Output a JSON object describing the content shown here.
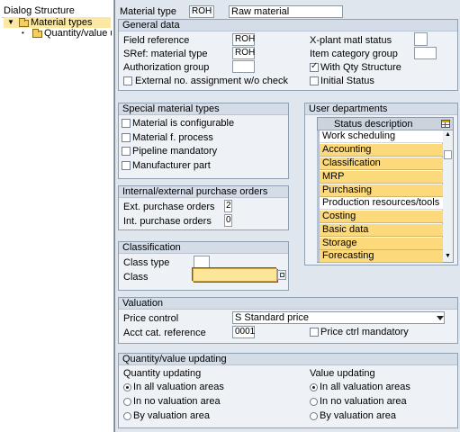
{
  "dialog_structure": {
    "title": "Dialog Structure",
    "items": [
      {
        "label": "Material types"
      },
      {
        "label": "Quantity/value upda"
      }
    ]
  },
  "header": {
    "material_type_label": "Material type",
    "material_type_code": "ROH",
    "material_type_desc": "Raw material"
  },
  "general_data": {
    "title": "General data",
    "field_reference_label": "Field reference",
    "field_reference_value": "ROH",
    "sref_label": "SRef: material type",
    "sref_value": "ROH",
    "auth_group_label": "Authorization group",
    "auth_group_value": "",
    "ext_no_label": "External no. assignment w/o check",
    "ext_no_checked": false,
    "xplant_label": "X-plant matl status",
    "xplant_value": "",
    "item_cat_label": "Item category group",
    "item_cat_value": "",
    "qty_structure_label": "With Qty Structure",
    "qty_structure_checked": true,
    "initial_status_label": "Initial Status",
    "initial_status_checked": false
  },
  "special_types": {
    "title": "Special material types",
    "items": [
      {
        "label": "Material is configurable",
        "checked": false
      },
      {
        "label": "Material f. process",
        "checked": false
      },
      {
        "label": "Pipeline mandatory",
        "checked": false
      },
      {
        "label": "Manufacturer part",
        "checked": false
      }
    ]
  },
  "purchase_orders": {
    "title": "Internal/external purchase orders",
    "ext_label": "Ext. purchase orders",
    "ext_value": "2",
    "int_label": "Int. purchase orders",
    "int_value": "0"
  },
  "classification": {
    "title": "Classification",
    "class_type_label": "Class type",
    "class_type_value": "",
    "class_label": "Class",
    "class_value": ""
  },
  "user_departments": {
    "title": "User departments",
    "column_header": "Status description",
    "rows": [
      {
        "label": "Work scheduling",
        "selected": false
      },
      {
        "label": "Accounting",
        "selected": true
      },
      {
        "label": "Classification",
        "selected": true
      },
      {
        "label": "MRP",
        "selected": true
      },
      {
        "label": "Purchasing",
        "selected": true
      },
      {
        "label": "Production resources/tools",
        "selected": false
      },
      {
        "label": "Costing",
        "selected": true
      },
      {
        "label": "Basic data",
        "selected": true
      },
      {
        "label": "Storage",
        "selected": true
      },
      {
        "label": "Forecasting",
        "selected": true
      }
    ]
  },
  "valuation": {
    "title": "Valuation",
    "price_control_label": "Price control",
    "price_control_value": "S Standard price",
    "acct_cat_label": "Acct cat. reference",
    "acct_cat_value": "0001",
    "price_ctrl_mandatory_label": "Price ctrl mandatory",
    "price_ctrl_mandatory_checked": false
  },
  "qty_value_updating": {
    "title": "Quantity/value updating",
    "quantity_title": "Quantity updating",
    "value_title": "Value updating",
    "options": [
      "In all valuation areas",
      "In no valuation area",
      "By valuation area"
    ],
    "quantity_selected": 0,
    "value_selected": 0
  },
  "colors": {
    "selected_row": "#fcd97a",
    "group_header": "#d4dde7",
    "tree_selection": "#fbe8a2"
  }
}
